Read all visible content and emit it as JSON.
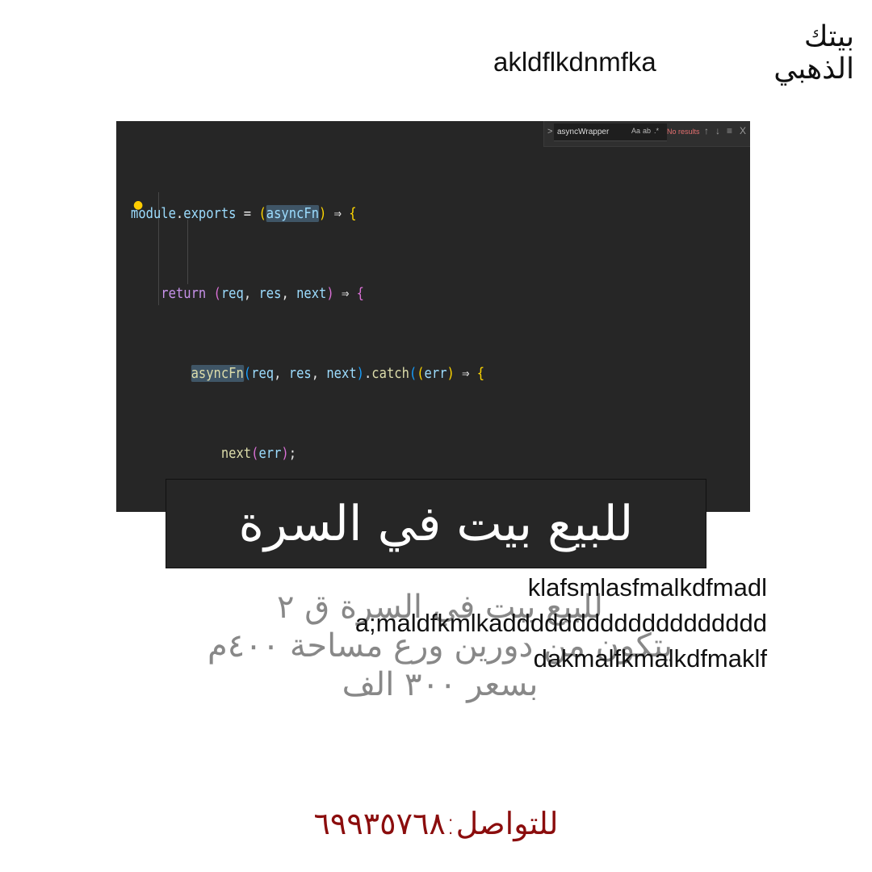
{
  "logo": {
    "line1": "بيتك",
    "line2": "الذهبي"
  },
  "top_text": "akldflkdnmfka",
  "editor": {
    "find": {
      "query": "asyncWrapper",
      "case_label": "Aa",
      "word_label": "ab",
      "regex_label": ".*",
      "status": "No results",
      "up": "↑",
      "down": "↓",
      "menu": "≡",
      "close": "X",
      "expand": ">"
    },
    "code_lines": [
      "module.exports = (asyncFn) => {",
      "    return (req, res, next) => {",
      "        asyncFn(req, res, next).catch((err) => {",
      "            next(err);",
      "        });",
      "    }",
      "}"
    ]
  },
  "banner_text": "للبيع بيت في السرة",
  "description_ar": {
    "line1": "للبيع بيت في السرة ق ٢",
    "line2": "يتكون من دورين ورع مساحة ٤٠٠م",
    "line3": "بسعر ٣٠٠ الف"
  },
  "description_en": {
    "line1": "klafsmlasfmalkdfmadl",
    "line2": "a;maldfkmlkaddddddddddddddddddd",
    "line3": "dakmalfkmalkdfmaklf"
  },
  "contact": "للتواصل:٦٩٩٣٥٧٦٨"
}
